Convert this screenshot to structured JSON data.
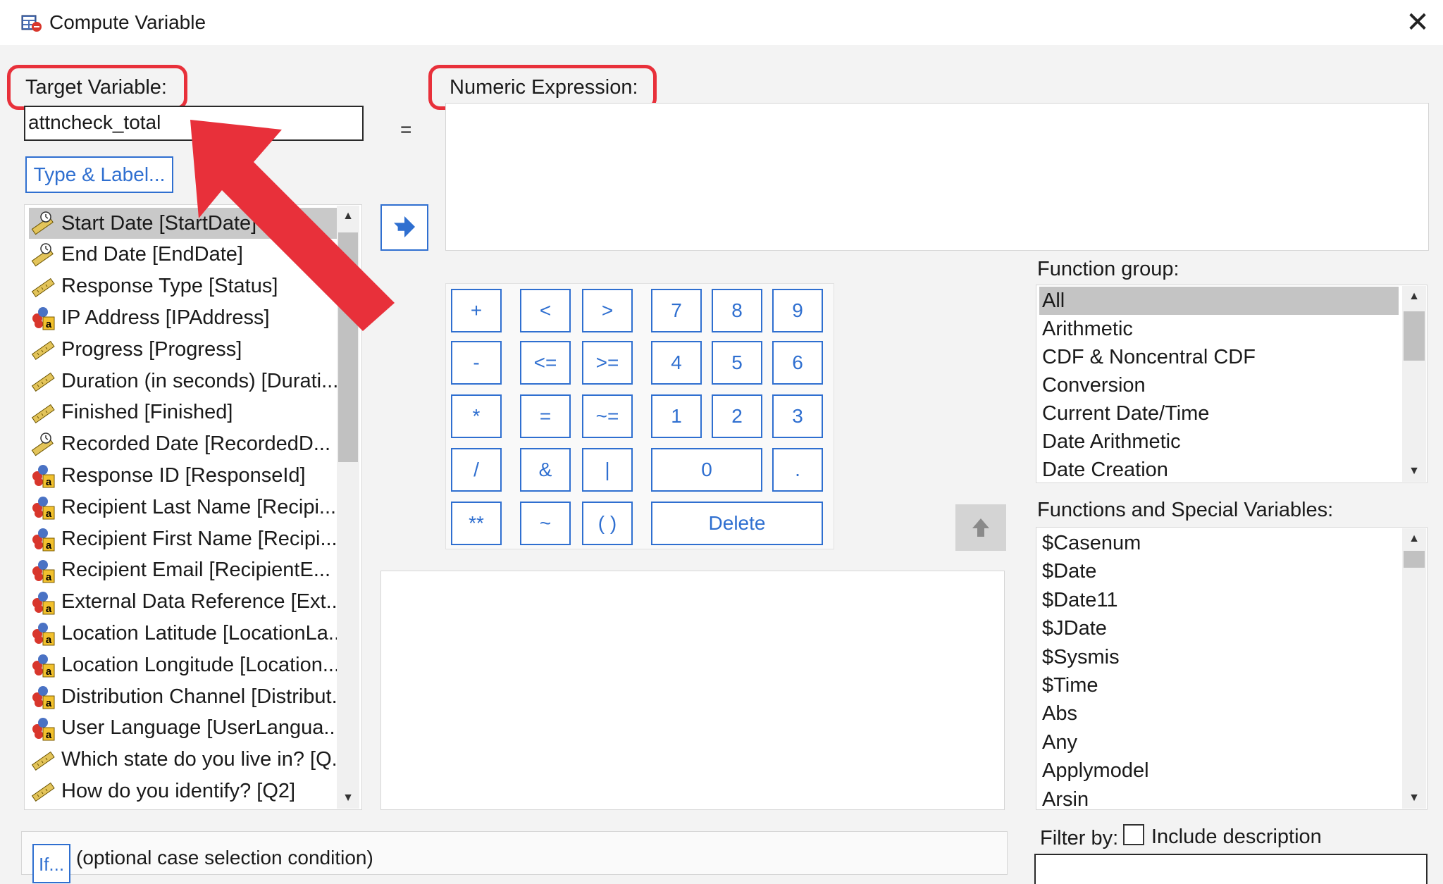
{
  "window": {
    "title": "Compute Variable"
  },
  "target_variable": {
    "label": "Target Variable:",
    "value": "attncheck_total",
    "type_label_button": "Type & Label..."
  },
  "equals_sign": "=",
  "numeric_expression": {
    "label": "Numeric Expression:",
    "value": ""
  },
  "variables": [
    {
      "label": "Start Date [StartDate]",
      "icon": "date-ruler-icon"
    },
    {
      "label": "End Date [EndDate]",
      "icon": "date-ruler-icon"
    },
    {
      "label": "Response Type [Status]",
      "icon": "scale-ruler-icon"
    },
    {
      "label": "IP Address [IPAddress]",
      "icon": "nominal-string-icon"
    },
    {
      "label": "Progress [Progress]",
      "icon": "scale-ruler-icon"
    },
    {
      "label": "Duration (in seconds) [Durati...",
      "icon": "scale-ruler-icon"
    },
    {
      "label": "Finished [Finished]",
      "icon": "scale-ruler-icon"
    },
    {
      "label": "Recorded Date [RecordedD...",
      "icon": "date-ruler-icon"
    },
    {
      "label": "Response ID [ResponseId]",
      "icon": "nominal-string-icon"
    },
    {
      "label": "Recipient Last Name [Recipi...",
      "icon": "nominal-string-icon"
    },
    {
      "label": "Recipient First Name [Recipi...",
      "icon": "nominal-string-icon"
    },
    {
      "label": "Recipient Email [RecipientE...",
      "icon": "nominal-string-icon"
    },
    {
      "label": "External Data Reference [Ext...",
      "icon": "nominal-string-icon"
    },
    {
      "label": "Location Latitude [LocationLa...",
      "icon": "nominal-string-icon"
    },
    {
      "label": "Location Longitude [Location...",
      "icon": "nominal-string-icon"
    },
    {
      "label": "Distribution Channel [Distribut...",
      "icon": "nominal-string-icon"
    },
    {
      "label": "User Language [UserLangua...",
      "icon": "nominal-string-icon"
    },
    {
      "label": "Which state do you live in? [Q...",
      "icon": "scale-ruler-icon"
    },
    {
      "label": "How do you identify? [Q2]",
      "icon": "scale-ruler-icon"
    }
  ],
  "selected_variable_index": 0,
  "keypad": {
    "plus": "+",
    "lt": "<",
    "gt": ">",
    "k7": "7",
    "k8": "8",
    "k9": "9",
    "minus": "-",
    "le": "<=",
    "ge": ">=",
    "k4": "4",
    "k5": "5",
    "k6": "6",
    "mult": "*",
    "eq": "=",
    "ne": "~=",
    "k1": "1",
    "k2": "2",
    "k3": "3",
    "div": "/",
    "and": "&",
    "or": "|",
    "k0": "0",
    "dot": ".",
    "pow": "**",
    "not": "~",
    "paren": "( )",
    "delete": "Delete"
  },
  "function_group": {
    "label": "Function group:",
    "items": [
      "All",
      "Arithmetic",
      "CDF & Noncentral CDF",
      "Conversion",
      "Current Date/Time",
      "Date Arithmetic",
      "Date Creation"
    ],
    "selected_index": 0
  },
  "functions": {
    "label": "Functions and Special Variables:",
    "items": [
      "$Casenum",
      "$Date",
      "$Date11",
      "$JDate",
      "$Sysmis",
      "$Time",
      "Abs",
      "Any",
      "Applymodel",
      "Arsin"
    ]
  },
  "filter": {
    "label": "Filter by:",
    "checkbox_label": "Include description",
    "checked": false,
    "value": ""
  },
  "if_condition": {
    "button": "If...",
    "text": "(optional case selection condition)"
  },
  "colors": {
    "accent_blue": "#2f6fd0",
    "callout_red": "#e8303a",
    "selection_gray": "#c4c4c4"
  }
}
